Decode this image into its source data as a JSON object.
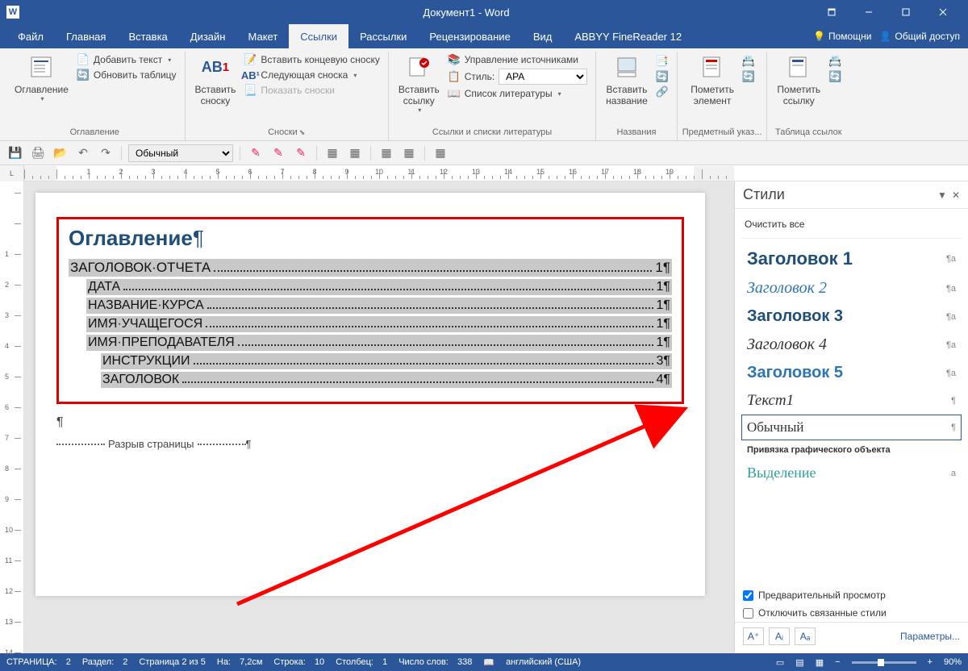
{
  "window": {
    "title": "Документ1 - Word"
  },
  "tabs": {
    "items": [
      "Файл",
      "Главная",
      "Вставка",
      "Дизайн",
      "Макет",
      "Ссылки",
      "Рассылки",
      "Рецензирование",
      "Вид",
      "ABBYY FineReader 12"
    ],
    "active_index": 5,
    "tell_me": "Помощни",
    "share": "Общий доступ"
  },
  "ribbon": {
    "toc": {
      "big": "Оглавление",
      "add_text": "Добавить текст",
      "update_table": "Обновить таблицу",
      "group": "Оглавление"
    },
    "footnotes": {
      "insert": "Вставить\nсноску",
      "ab_mark": "AB¹",
      "end_note": "Вставить концевую сноску",
      "next": "Следующая сноска",
      "show": "Показать сноски",
      "group": "Сноски"
    },
    "citations": {
      "insert": "Вставить\nссылку",
      "manage": "Управление источниками",
      "style_label": "Стиль:",
      "style_value": "APA",
      "biblio": "Список литературы",
      "group": "Ссылки и списки литературы"
    },
    "captions": {
      "insert": "Вставить\nназвание",
      "group": "Названия"
    },
    "index": {
      "mark": "Пометить\nэлемент",
      "group": "Предметный указ..."
    },
    "toa": {
      "mark": "Пометить\nссылку",
      "group": "Таблица ссылок"
    }
  },
  "qat": {
    "style_selector": "Обычный"
  },
  "document": {
    "toc_title": "Оглавление",
    "entries": [
      {
        "text": "ЗАГОЛОВОК·ОТЧЕТА",
        "page": "1",
        "indent": 0
      },
      {
        "text": "ДАТА",
        "page": "1",
        "indent": 1
      },
      {
        "text": "НАЗВАНИЕ·КУРСА",
        "page": "1",
        "indent": 1
      },
      {
        "text": "ИМЯ·УЧАЩЕГОСЯ",
        "page": "1",
        "indent": 1
      },
      {
        "text": "ИМЯ·ПРЕПОДАВАТЕЛЯ",
        "page": "1",
        "indent": 1
      },
      {
        "text": "ИНСТРУКЦИИ",
        "page": "3",
        "indent": 2
      },
      {
        "text": "ЗАГОЛОВОК",
        "page": "4",
        "indent": 2
      }
    ],
    "page_break": "Разрыв страницы"
  },
  "styles_pane": {
    "title": "Стили",
    "clear_all": "Очистить все",
    "items": [
      {
        "name": "Заголовок 1",
        "css": "font-weight:900;font-size:22px;color:#1f4e79;font-family:Arial,sans-serif;",
        "mark": "¶a"
      },
      {
        "name": "Заголовок 2",
        "css": "font-style:italic;font-size:20px;color:#2e75b6;font-family:'Times New Roman',serif;",
        "mark": "¶a"
      },
      {
        "name": "Заголовок 3",
        "css": "font-weight:900;font-size:20px;color:#1f4e79;font-family:Arial,sans-serif;",
        "mark": "¶a"
      },
      {
        "name": "Заголовок 4",
        "css": "font-style:italic;font-size:20px;color:#333;font-family:'Times New Roman',serif;",
        "mark": "¶a"
      },
      {
        "name": "Заголовок 5",
        "css": "font-weight:900;font-size:20px;color:#2e75b6;font-family:Arial,sans-serif;",
        "mark": "¶a"
      },
      {
        "name": "Текст1",
        "css": "font-style:italic;font-size:19px;color:#333;font-family:'Times New Roman',serif;",
        "mark": "¶"
      },
      {
        "name": "Обычный",
        "css": "font-size:17px;color:#333;font-family:'Times New Roman',serif;",
        "mark": "¶",
        "selected": true
      },
      {
        "name": "Привязка графического объекта",
        "css": "font-size:11px;color:#333;font-family:Arial,sans-serif;font-weight:600;",
        "mark": ""
      },
      {
        "name": "Выделение",
        "css": "font-size:18px;color:#2e9e9e;font-family:'Times New Roman',serif;",
        "mark": "a"
      }
    ],
    "preview_chk": "Предварительный просмотр",
    "disable_linked": "Отключить связанные стили",
    "params": "Параметры..."
  },
  "statusbar": {
    "page_label": "СТРАНИЦА:",
    "page_val": "2",
    "section_label": "Раздел:",
    "section_val": "2",
    "page_of": "Страница 2 из 5",
    "at_label": "На:",
    "at_val": "7,2см",
    "line_label": "Строка:",
    "line_val": "10",
    "col_label": "Столбец:",
    "col_val": "1",
    "words_label": "Число слов:",
    "words_val": "338",
    "lang": "английский (США)",
    "zoom": "90%"
  }
}
